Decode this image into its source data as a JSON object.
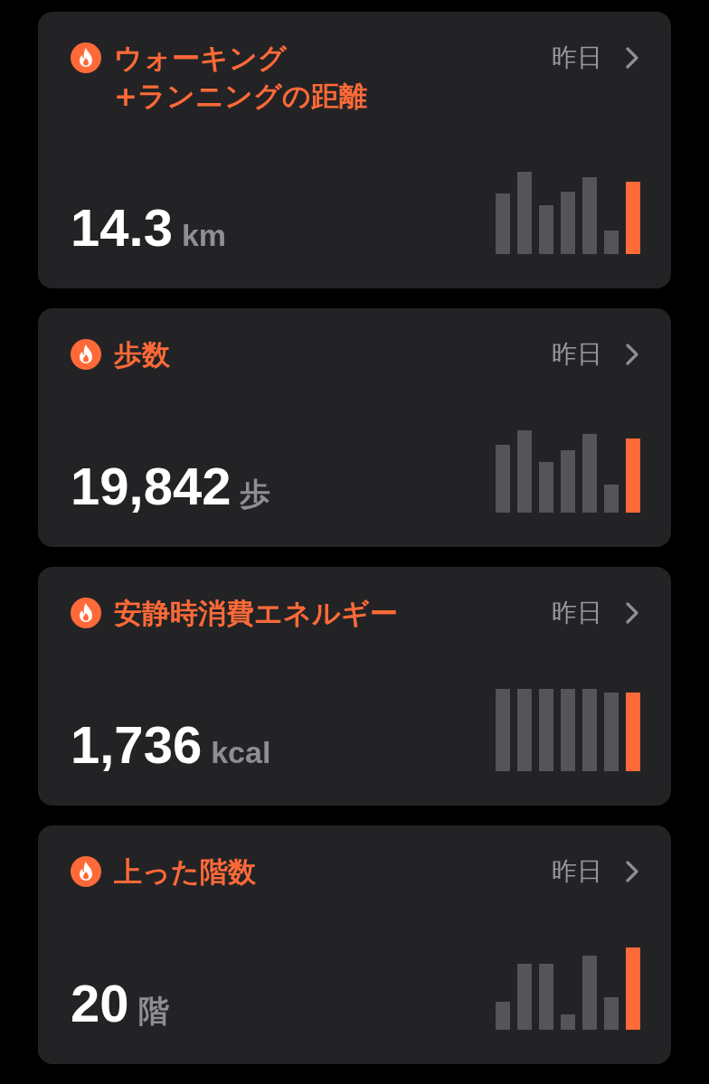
{
  "cards": [
    {
      "title_lines": [
        "ウォーキング",
        "+ランニングの距離"
      ],
      "date": "昨日",
      "value": "14.3",
      "unit": "km"
    },
    {
      "title_lines": [
        "歩数"
      ],
      "date": "昨日",
      "value": "19,842",
      "unit": "歩"
    },
    {
      "title_lines": [
        "安静時消費エネルギー"
      ],
      "date": "昨日",
      "value": "1,736",
      "unit": "kcal"
    },
    {
      "title_lines": [
        "上った階数"
      ],
      "date": "昨日",
      "value": "20",
      "unit": "階"
    }
  ]
}
